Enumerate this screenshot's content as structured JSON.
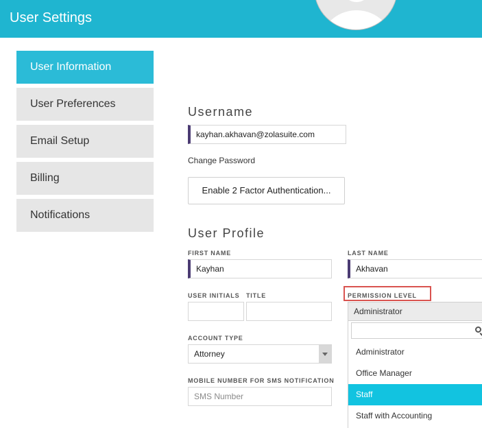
{
  "header": {
    "title": "User Settings"
  },
  "sidebar": {
    "items": [
      {
        "label": "User Information",
        "active": true
      },
      {
        "label": "User Preferences",
        "active": false
      },
      {
        "label": "Email Setup",
        "active": false
      },
      {
        "label": "Billing",
        "active": false
      },
      {
        "label": "Notifications",
        "active": false
      }
    ]
  },
  "username_section": {
    "title": "Username",
    "value": "kayhan.akhavan@zolasuite.com",
    "change_password": "Change Password",
    "two_factor_button": "Enable 2 Factor Authentication..."
  },
  "profile": {
    "title": "User Profile",
    "first_name_label": "FIRST NAME",
    "first_name": "Kayhan",
    "last_name_label": "LAST NAME",
    "last_name": "Akhavan",
    "initials_label": "USER INITIALS",
    "initials": "",
    "title_label": "TITLE",
    "title_value": "",
    "account_type_label": "ACCOUNT TYPE",
    "account_type": "Attorney",
    "mobile_label": "MOBILE NUMBER FOR SMS NOTIFICATION",
    "mobile_placeholder": "SMS Number",
    "permission_label": "PERMISSION LEVEL",
    "permission_selected": "Administrator",
    "permission_options": [
      "Administrator",
      "Office Manager",
      "Staff",
      "Staff with Accounting"
    ],
    "permission_highlighted": "Staff"
  },
  "colors": {
    "header": "#1fb5d0",
    "nav_active": "#2bbbd7",
    "option_highlight": "#12c3e0",
    "input_accent": "#4b3b73",
    "annotation_box": "#d9534f"
  },
  "icons": {
    "search": "search-icon",
    "dropdown": "chevron-down-icon",
    "avatar": "user-avatar"
  }
}
